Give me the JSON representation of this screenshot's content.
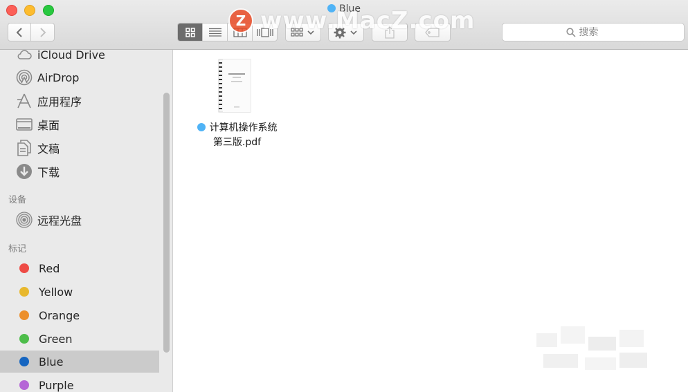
{
  "window": {
    "title": "Blue",
    "title_tag_color": "#4fb3f6"
  },
  "watermark": {
    "logo": "Z",
    "text": "www.MacZ.com"
  },
  "toolbar": {
    "back_icon": "chevron-left-icon",
    "forward_icon": "chevron-right-icon",
    "view_modes": [
      "icon-view",
      "list-view",
      "column-view",
      "coverflow-view"
    ],
    "active_view": "icon-view",
    "search_placeholder": "搜索"
  },
  "sidebar": {
    "favorites": [
      {
        "label": "iCloud Drive",
        "icon": "cloud-icon"
      },
      {
        "label": "AirDrop",
        "icon": "airdrop-icon"
      },
      {
        "label": "应用程序",
        "icon": "applications-icon"
      },
      {
        "label": "桌面",
        "icon": "desktop-icon"
      },
      {
        "label": "文稿",
        "icon": "documents-icon"
      },
      {
        "label": "下载",
        "icon": "download-icon"
      }
    ],
    "devices_heading": "设备",
    "devices": [
      {
        "label": "远程光盘",
        "icon": "disc-icon"
      }
    ],
    "tags_heading": "标记",
    "tags": [
      {
        "label": "Red",
        "color": "#ee4b45"
      },
      {
        "label": "Yellow",
        "color": "#e8b82d"
      },
      {
        "label": "Orange",
        "color": "#ec8f2c"
      },
      {
        "label": "Green",
        "color": "#4dbd4a"
      },
      {
        "label": "Blue",
        "color": "#1565c0",
        "selected": true
      },
      {
        "label": "Purple",
        "color": "#b566d6"
      }
    ]
  },
  "files": [
    {
      "name_line1": "计算机操作系统",
      "name_line2": "第三版.pdf",
      "tag_color": "#4fb3f6"
    }
  ]
}
